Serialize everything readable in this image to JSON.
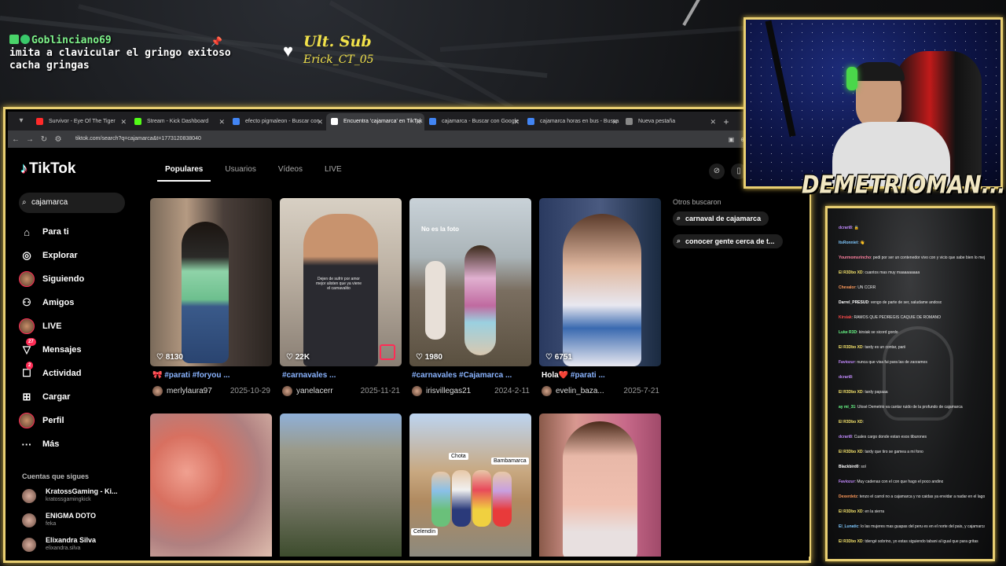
{
  "overlay": {
    "chat_user": "Goblinciano69",
    "chat_text_line1": "imita a clavicular el gringo exitoso",
    "chat_text_line2": "cacha gringas",
    "sub_title": "Ult. Sub",
    "sub_name": "Erick_CT_05",
    "streamer_name": "DEMETRIOMAN....",
    "accent": "#e9cf72"
  },
  "browser": {
    "tabs": [
      {
        "label": "Survivor - Eye Of The Tiger",
        "fav": "#ff2a2a"
      },
      {
        "label": "Stream - Kick Dashboard",
        "fav": "#53fc18"
      },
      {
        "label": "efecto pigmaleon - Buscar con",
        "fav": "#4285f4"
      },
      {
        "label": "Encuentra 'cajamarca' en TikTok",
        "fav": "#ffffff"
      },
      {
        "label": "cajamarca - Buscar con Google",
        "fav": "#4285f4"
      },
      {
        "label": "cajamarca horas en bus - Busca",
        "fav": "#4285f4"
      },
      {
        "label": "Nueva pestaña",
        "fav": "#888888"
      }
    ],
    "url": "tiktok.com/search?q=cajamarca&t=1773120838040"
  },
  "tiktok": {
    "brand": "TikTok",
    "search_value": "cajamarca",
    "nav": [
      {
        "label": "Para ti",
        "icon": "home-icon",
        "glyph": "⌂"
      },
      {
        "label": "Explorar",
        "icon": "compass-icon",
        "glyph": "◎"
      },
      {
        "label": "Siguiendo",
        "icon": "avatar-icon",
        "glyph": ""
      },
      {
        "label": "Amigos",
        "icon": "friends-icon",
        "glyph": "⚇"
      },
      {
        "label": "LIVE",
        "icon": "live-avatar-icon",
        "glyph": ""
      },
      {
        "label": "Mensajes",
        "icon": "messages-icon",
        "glyph": "▽",
        "badge": "27"
      },
      {
        "label": "Actividad",
        "icon": "activity-icon",
        "glyph": "☐",
        "badge": "2"
      },
      {
        "label": "Cargar",
        "icon": "upload-icon",
        "glyph": "⊞"
      },
      {
        "label": "Perfil",
        "icon": "profile-icon",
        "glyph": ""
      },
      {
        "label": "Más",
        "icon": "more-icon",
        "glyph": "···"
      }
    ],
    "following_heading": "Cuentas que sigues",
    "following": [
      {
        "name": "KratossGaming - Ki...",
        "handle": "kratossgamingkick"
      },
      {
        "name": "ENIGMA DOTO",
        "handle": "feka"
      },
      {
        "name": "Elixandra Silva",
        "handle": "elixandra.silva"
      }
    ],
    "tabs": [
      "Populares",
      "Usuarios",
      "Vídeos",
      "LIVE"
    ],
    "active_tab": "Populares",
    "videos": [
      {
        "likes": "8130",
        "caption_pre": "🎀 ",
        "tags": "#parati #foryou ...",
        "user": "merlylaura97",
        "date": "2025-10-29"
      },
      {
        "likes": "22K",
        "caption_pre": "",
        "tags": "#carnavales ...",
        "user": "yanelacerr",
        "date": "2025-11-21"
      },
      {
        "likes": "1980",
        "caption_pre": "",
        "tags": "#carnavales #Cajamarca ...",
        "user": "irisvillegas21",
        "date": "2024-2-11"
      },
      {
        "likes": "6751",
        "caption_pre": "Hola❤️ ",
        "tags": "#parati ...",
        "user": "evelin_baza...",
        "date": "2025-7-21"
      }
    ],
    "overlay_texts": {
      "no_es_la_foto": "No es la foto",
      "chota": "Chota",
      "bambamarca": "Bambamarca",
      "celendin": "Celendín"
    },
    "others_heading": "Otros buscaron",
    "others": [
      "carnaval de cajamarca",
      "conocer gente cerca de t..."
    ]
  },
  "stream_chat": {
    "lines": [
      {
        "user": "dcrart8",
        "text": "🔒",
        "color": "#c28bff"
      },
      {
        "user": "ItsRonniet",
        "text": "👋",
        "color": "#7fc8ff"
      },
      {
        "user": "Yourmomsrincho",
        "text": "pedi por ser un contenedor vivo con y vicio que sabe bien lo mejor y pardes facs sabrie",
        "color": "#ff80a0"
      },
      {
        "user": "El R3Dbo XD",
        "text": "cuantos mas muy maaaaaaaaa",
        "color": "#f5e36b"
      },
      {
        "user": "Chevalor",
        "text": "UN CCRR",
        "color": "#ff9a5a"
      },
      {
        "user": "Darrel_PRESUD",
        "text": "vengo de parte de ser, saludame andoso",
        "color": "#ffffff"
      },
      {
        "user": "Kirsiak",
        "text": "RAMOS QUE PEDREGIS CAQUIE DE ROMANO",
        "color": "#ff4a4a"
      },
      {
        "user": "Luke R3D",
        "text": "kirsiak se sicord gordo",
        "color": "#6bff8a"
      },
      {
        "user": "El R3Dbo XD",
        "text": "tardy es un contar, parii",
        "color": "#f5e36b"
      },
      {
        "user": "Faviozur",
        "text": "nunca que visa fui para las de zarzamos",
        "color": "#c48aff"
      },
      {
        "user": "dcrart8",
        "text": "",
        "color": "#c28bff"
      },
      {
        "user": "El R3Dbo XD",
        "text": "tardy papaaa",
        "color": "#f5e36b"
      },
      {
        "user": "ay mi_31",
        "text": "Ulosé Demetrio va cantar ruido de la profundo de cajamarca",
        "color": "#6bff8a"
      },
      {
        "user": "El R3Dbo XD",
        "text": "",
        "color": "#f5e36b"
      },
      {
        "user": "dcrart8",
        "text": "Cuales cargo donde estan esos tiburones",
        "color": "#c28bff"
      },
      {
        "user": "El R3Dbo XD",
        "text": "tardy que tiro se gamea a mi fono",
        "color": "#f5e36b"
      },
      {
        "user": "Blackbird0",
        "text": "sol",
        "color": "#ffffff"
      },
      {
        "user": "Faviozur",
        "text": "Muy cadenas con el con que hago el poco andino",
        "color": "#c48aff"
      },
      {
        "user": "Dexerdetz",
        "text": "tenzo el carrol no a cajamarca y no caidas ya envidar a nadar en el lago como una lebiga en su hablaje",
        "color": "#ff9a5a"
      },
      {
        "user": "El R3Dbo XD",
        "text": "en la sierra",
        "color": "#f5e36b"
      },
      {
        "user": "El_Lunatic",
        "text": "lo las mujeres mas guapas del peru es en el norte del pais, y cajamarca es el norte de la sierra",
        "color": "#7fc8ff"
      },
      {
        "user": "El R3Dbo XD",
        "text": "tdengé sobrino, yo estas siguiendo tabani al igual que para gritas",
        "color": "#f5e36b"
      }
    ]
  }
}
